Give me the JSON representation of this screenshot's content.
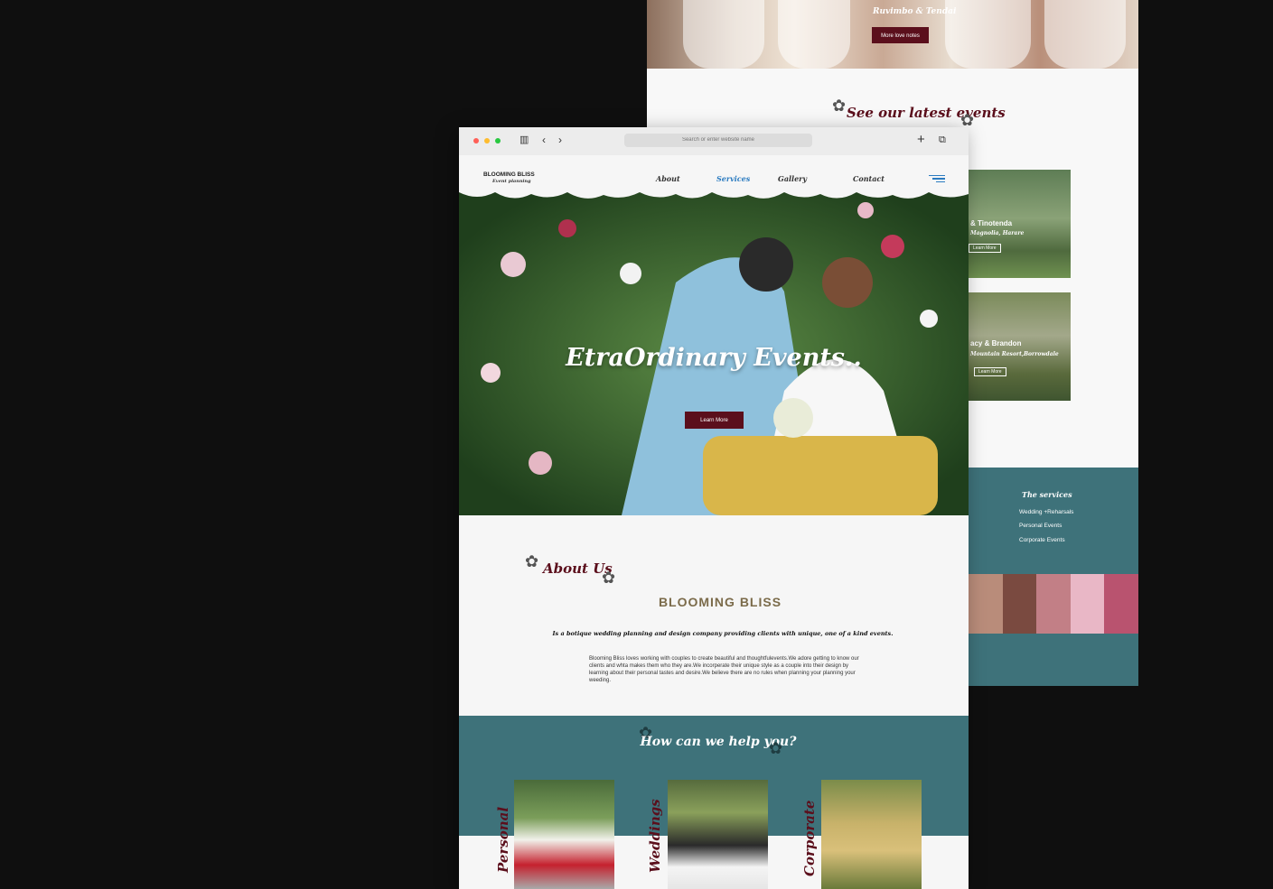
{
  "colors": {
    "accent": "#5b0f1c",
    "teal": "#3e727a",
    "nav_active": "#2b7bc0",
    "canvas": "#0f0f0f"
  },
  "back_page": {
    "hero_names": "Ruvimbo & Tendai",
    "love_notes_button": "More love notes",
    "latest_events_title": "See our latest events",
    "events": [
      {
        "title": "& Tinotenda",
        "location": "Magnolia, Harare",
        "button": "Learn More"
      },
      {
        "title": "acy & Brandon",
        "location": "Mountain Resort,Borrowdale",
        "button": "Learn More"
      }
    ],
    "services_title": "The services",
    "services": [
      "Wedding +Reharsals",
      "Personal Events",
      "Corporate Events"
    ]
  },
  "browser": {
    "search_placeholder": "Search or enter website name"
  },
  "nav": {
    "brand": "BLOOMING BLISS",
    "brand_sub": "Event planning",
    "links": [
      "About",
      "Services",
      "Gallery",
      "Contact"
    ]
  },
  "hero": {
    "title": "EtraOrdinary Events..",
    "button": "Learn More"
  },
  "about": {
    "title": "About Us",
    "brand": "BLOOMING BLISS",
    "tagline": "Is a  botique wedding planning and design company providing clients with unique, one of a kind events.",
    "body": "Blooming Bliss loves working with couples  to create  beautiful and thoughtfulevents.We adore getting to know our clients and whta makes them who they are.We incorperate their unique style as a couple into their design by learning about their personal tastes and desire.We believe there are no rules when planning your planning your weeding."
  },
  "help": {
    "title": "How can we help you?",
    "cards": [
      "Personal",
      "Weddings",
      "Corporate"
    ]
  }
}
